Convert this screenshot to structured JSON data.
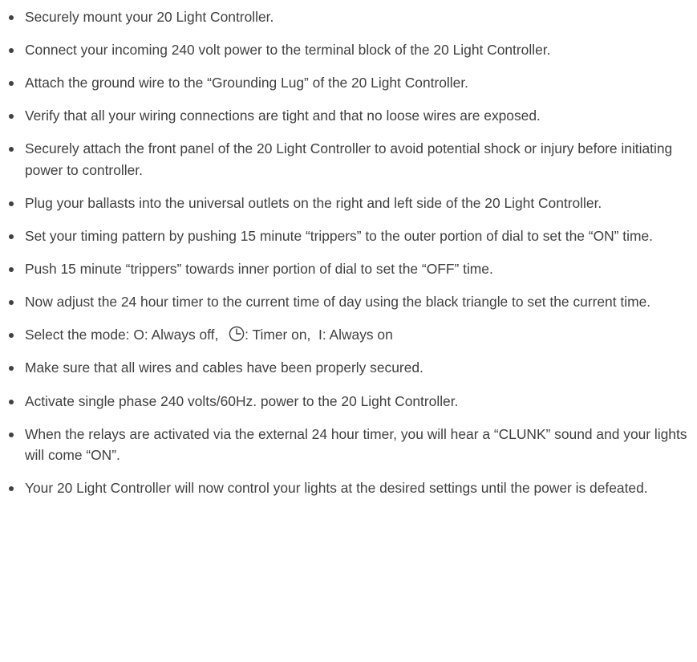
{
  "steps": [
    "Securely mount your 20 Light Controller.",
    "Connect your incoming 240 volt power to the terminal block of the 20 Light Controller.",
    "Attach the ground wire to the “Grounding Lug” of the 20 Light Controller.",
    "Verify that all your wiring connections are tight and that no loose wires are exposed.",
    "Securely attach the front panel of the 20 Light Controller to avoid potential shock or injury before initiating power to controller.",
    "Plug your ballasts into the universal outlets on the right and left side of the 20 Light Controller.",
    "Set your timing pattern by pushing 15 minute “trippers” to the outer portion of dial to set the “ON” time.",
    "Push 15 minute “trippers” towards inner portion of dial to set the “OFF” time.",
    "Now adjust the 24 hour timer to the current time of day using the black triangle to set the current time.",
    {
      "before_icon": "Select the mode: O: Always off, ",
      "icon": "clock-timer-icon",
      "after_icon": ": Timer on,  I: Always on"
    },
    "Make sure that all wires and cables have been properly secured.",
    "Activate single phase 240 volts/60Hz. power to the 20 Light Controller.",
    "When the relays are activated via the external 24 hour timer, you will hear a “CLUNK” sound and your lights will come “ON”.",
    "Your 20 Light Controller will now control your lights at the desired settings until the power is defeated."
  ],
  "colors": {
    "text": "#404040",
    "background": "#ffffff"
  }
}
